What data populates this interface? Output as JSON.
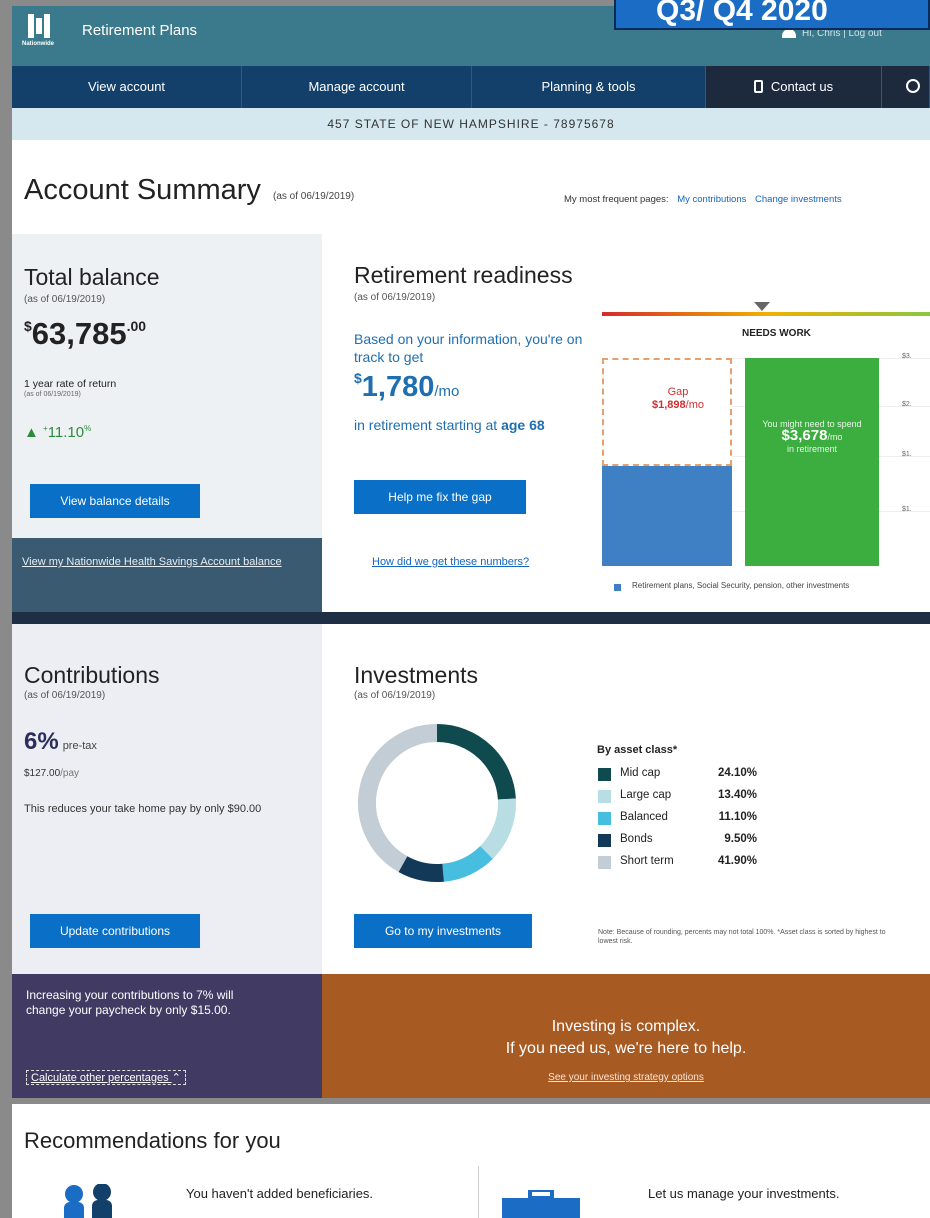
{
  "corner_badge": "Q3/ Q4 2020",
  "header": {
    "brand": "Nationwide",
    "app_title": "Retirement Plans",
    "user_text": "Hi, Chris  |  Log out"
  },
  "nav": {
    "view_account": "View account",
    "manage_account": "Manage account",
    "planning_tools": "Planning & tools",
    "contact_us": "Contact us"
  },
  "plan_bar": "457 STATE OF NEW HAMPSHIRE - 78975678",
  "page": {
    "title": "Account Summary",
    "as_of": "(as of 06/19/2019)",
    "frequent_label": "My most frequent pages:",
    "frequent_links": [
      "My contributions",
      "Change investments"
    ]
  },
  "total_balance": {
    "heading": "Total balance",
    "as_of": "(as of 06/19/2019)",
    "currency": "$",
    "amount": "63,785",
    "cents": ".00",
    "ror_label": "1 year rate of return",
    "ror_as_of": "(as of 06/19/2019)",
    "ror_value": "11.10",
    "ror_suffix": "%",
    "button": "View balance details",
    "hsa_link": "View my Nationwide Health Savings Account balance"
  },
  "readiness": {
    "heading": "Retirement readiness",
    "as_of": "(as of 06/19/2019)",
    "intro": "Based on your information, you're on track to get",
    "currency": "$",
    "amount": "1,780",
    "per": "/mo",
    "start_text": "in retirement starting at",
    "start_age": "age 68",
    "button": "Help me fix the gap",
    "how_link": "How did we get these numbers?",
    "status": "NEEDS WORK",
    "gap_label": "Gap",
    "gap_value": "$1,898",
    "gap_per": "/mo",
    "need_line1": "You might need to spend",
    "need_value": "$3,678",
    "need_per": "/mo",
    "need_line2": "in retirement",
    "ticks": [
      "$3.",
      "$2.",
      "$1.",
      "$1."
    ],
    "legend": "Retirement plans, Social Security, pension, other investments"
  },
  "contributions": {
    "heading": "Contributions",
    "as_of": "(as of 06/19/2019)",
    "pct": "6%",
    "pct_type": "pre-tax",
    "per_pay": "$127.00",
    "per_pay_unit": "/pay",
    "note": "This reduces your take home pay by only $90.00",
    "button": "Update contributions"
  },
  "investments": {
    "heading": "Investments",
    "as_of": "(as of 06/19/2019)",
    "asset_title": "By asset class*",
    "assets": [
      {
        "name": "Mid cap",
        "pct": "24.10%",
        "value": 24.1,
        "color": "#0f4a4f"
      },
      {
        "name": "Large cap",
        "pct": "13.40%",
        "value": 13.4,
        "color": "#b8dde3"
      },
      {
        "name": "Balanced",
        "pct": "11.10%",
        "value": 11.1,
        "color": "#47bde0"
      },
      {
        "name": "Bonds",
        "pct": "9.50%",
        "value": 9.5,
        "color": "#123a58"
      },
      {
        "name": "Short term",
        "pct": "41.90%",
        "value": 41.9,
        "color": "#c2cdd6"
      }
    ],
    "button": "Go to my investments",
    "note": "Note: Because of rounding, percents may not total 100%. *Asset class is sorted by highest to lowest risk."
  },
  "promo": {
    "left_text": "Increasing your contributions to 7% will change your paycheck by only $15.00.",
    "calc_link": "Calculate other percentages",
    "right_line1": "Investing is complex.",
    "right_line2": "If you need us, we're here to help.",
    "right_link": "See your investing strategy options"
  },
  "recommendations": {
    "title": "Recommendations for you",
    "items": [
      "You haven't added beneficiaries.",
      "Let us manage your investments."
    ]
  },
  "colors": {
    "topbar": "#3b7a8c",
    "nav": "#13406b",
    "button": "#0a6fc7",
    "green_bar": "#3bae3f",
    "blue_bar": "#3f7fc4",
    "promo_left": "#413b63",
    "promo_right": "#a85a23"
  }
}
